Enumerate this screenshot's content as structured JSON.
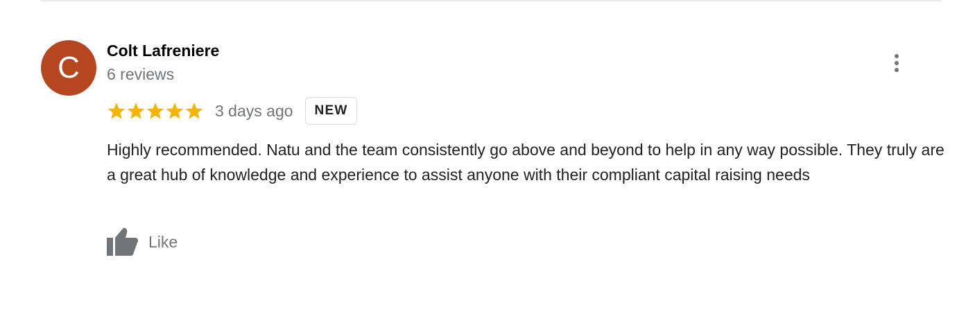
{
  "review": {
    "avatar_letter": "C",
    "avatar_color": "#b5461f",
    "author_name": "Colt Lafreniere",
    "review_count": "6 reviews",
    "rating": 5,
    "rating_max": 5,
    "star_color": "#f4b400",
    "date": "3 days ago",
    "badge": "NEW",
    "text": "Highly recommended. Natu and the team consistently go above and beyond to help in any way possible. They truly are a great hub of knowledge and experience to assist anyone with their compliant capital raising needs",
    "like_label": "Like",
    "more_icon": "more-vert-icon",
    "like_icon": "thumb-up-icon"
  }
}
